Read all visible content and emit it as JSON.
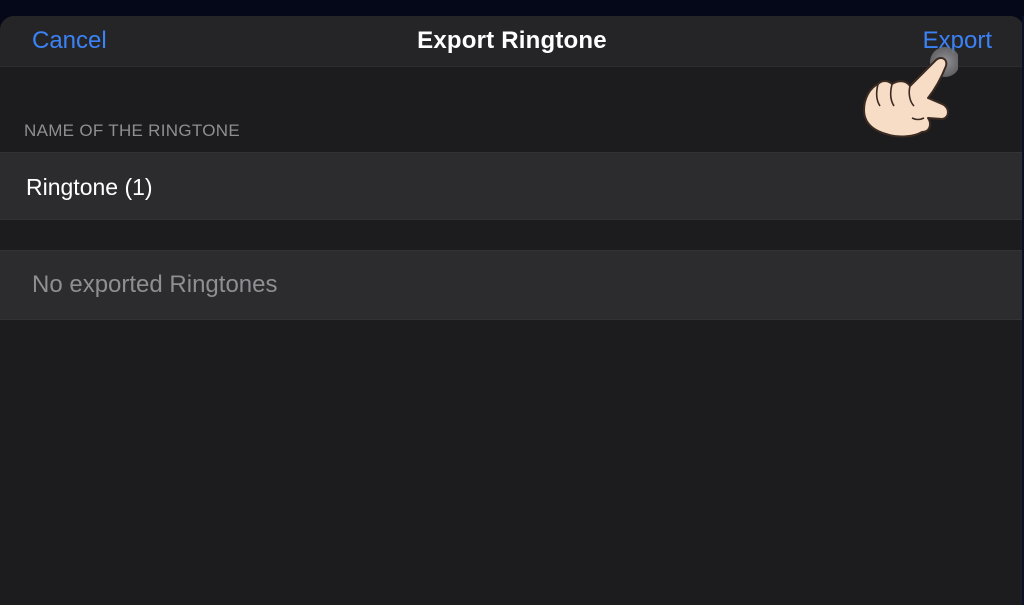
{
  "navbar": {
    "cancel_label": "Cancel",
    "title": "Export Ringtone",
    "export_label": "Export"
  },
  "form": {
    "section_header": "NAME OF THE RINGTONE",
    "name_value": "Ringtone (1)"
  },
  "exports": {
    "empty_message": "No exported Ringtones"
  },
  "colors": {
    "accent": "#3b82f6",
    "background": "#1c1c1e",
    "row": "#2c2c2e",
    "secondary_text": "#8e8e93"
  },
  "icons": {
    "tap_hand": "pointing-hand-icon"
  }
}
